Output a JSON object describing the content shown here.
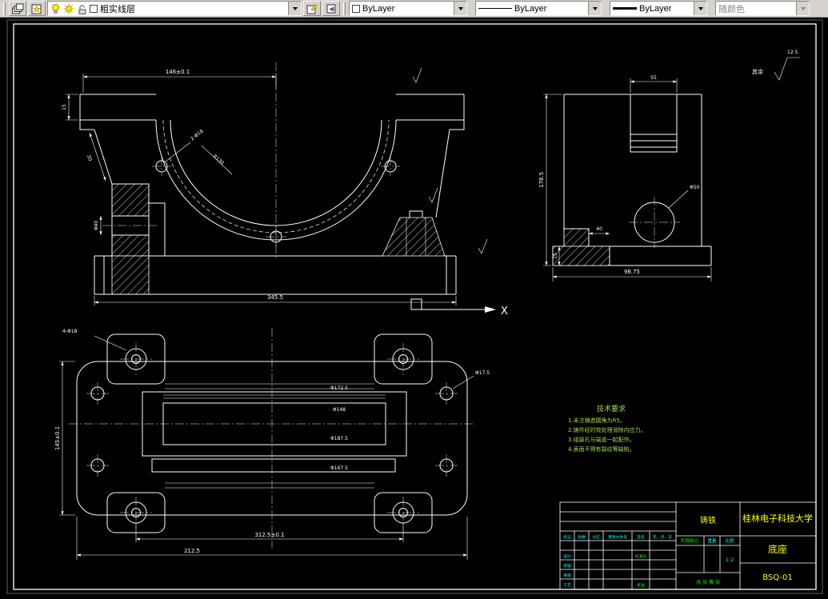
{
  "toolbar": {
    "layer_combo": {
      "value": "粗实线层"
    },
    "color_combo": {
      "value": "ByLayer"
    },
    "linetype_combo": {
      "value": "ByLayer"
    },
    "lineweight_combo": {
      "value": "ByLayer"
    },
    "plotstyle_combo": {
      "value": "随颜色"
    }
  },
  "drawing": {
    "surface_finish": {
      "label": "其余",
      "roughness": "12.5"
    },
    "ucs": {
      "x_label": "X"
    },
    "tech_notes": {
      "title": "技术要求",
      "lines": [
        "1.未注铸造圆角为R5。",
        "2.铸件经时效处理消除内应力。",
        "3.组装孔与端盖一起配作。",
        "4.表面不得有裂纹等缺陷。"
      ]
    },
    "dims": {
      "front_top": "146±0.1",
      "front_bottom": "345.5",
      "front_height": "15",
      "front_slope": "30",
      "front_bore": "Φ40",
      "front_bolt_holes": "2-Φ18",
      "front_radius": "R130",
      "side_height": "178.5",
      "side_width": "98.75",
      "side_slot": "55",
      "side_circle": "Φ50",
      "side_step_w": "40",
      "side_step_h": "15",
      "plan_corner_holes": "4-Φ18",
      "plan_height": "145±0.1",
      "plan_w1": "Φ172.5",
      "plan_w2": "Φ148",
      "plan_w3": "Φ187.5",
      "plan_w4": "Φ167.5",
      "plan_inner_span": "312.5±0.1",
      "plan_outer_span": "212.5",
      "plan_side_hole": "Φ17.5"
    },
    "title_block": {
      "university": "桂林电子科技大学",
      "material": "铸铁",
      "part_name": "底座",
      "drawing_number": "BSQ-01",
      "stage_label": "阶段标记",
      "weight_label": "重量",
      "scale_label": "比例",
      "scale_value": "1:2",
      "sheet_note": "共 张 第 张",
      "header": {
        "mark": "标记",
        "count": "处数",
        "zone": "分区",
        "change_file": "更改文件号",
        "sign": "签名",
        "date": "年、月、日"
      },
      "roles": {
        "design": "设计",
        "check": "校核",
        "review": "审核",
        "process": "工艺",
        "approve": "批准",
        "standard": "标准化"
      }
    }
  }
}
